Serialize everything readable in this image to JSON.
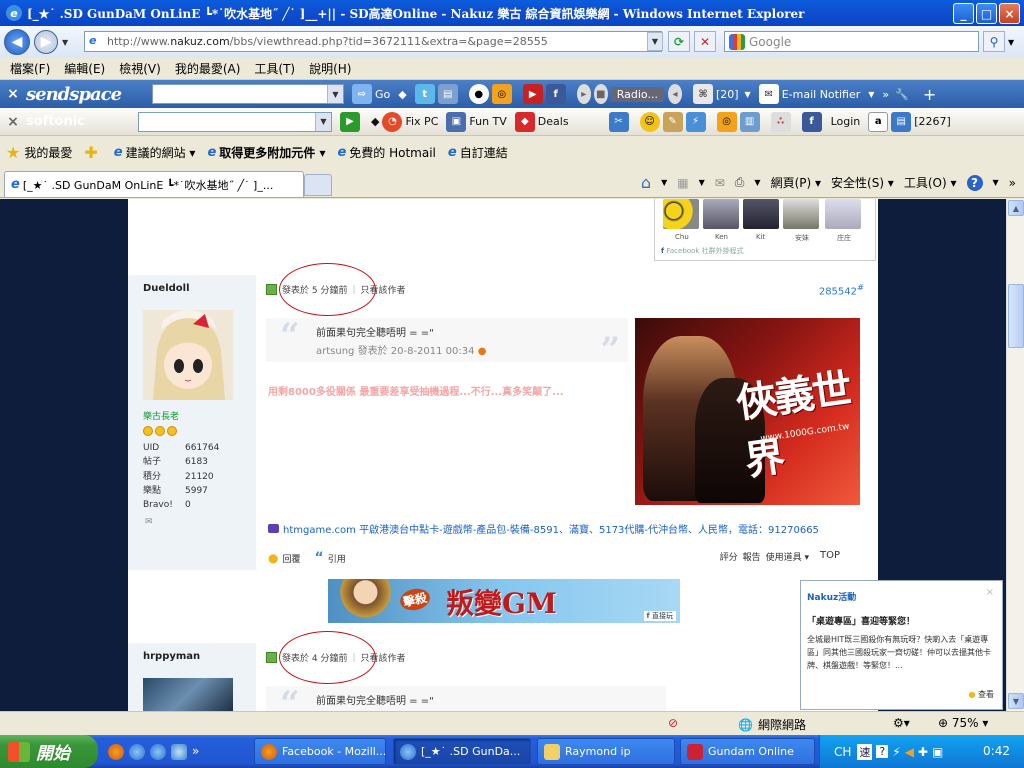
{
  "window": {
    "title": "[_★˙ .SD GunDaM OnLinE ┗*˙吹水基地˝ ╱˙ ]__+|| - SD高達Online - Nakuz 樂古 綜合資訊娛樂網 - Windows Internet Explorer",
    "controls": [
      "_",
      "□",
      "×"
    ]
  },
  "address": {
    "url_prefix": "http://www.",
    "url_domain": "nakuz.com",
    "url_path": "/bbs/viewthread.php?tid=3672111&extra=&page=28555",
    "search_placeholder": "Google"
  },
  "menu": [
    "檔案(F)",
    "編輯(E)",
    "檢視(V)",
    "我的最愛(A)",
    "工具(T)",
    "說明(H)"
  ],
  "toolbar1": {
    "brand": "sendspace",
    "go_label": "Go",
    "radio_label": "Radio...",
    "count_label": "[20]",
    "email_label": "E-mail Notifier"
  },
  "toolbar2": {
    "brand": "softonic",
    "fixpc": "Fix PC",
    "funtv": "Fun TV",
    "deals": "Deals",
    "login": "Login",
    "count": "[2267]"
  },
  "favorites": {
    "label": "我的最愛",
    "items": [
      "建議的網站 ▾",
      "取得更多附加元件 ▾",
      "免費的 Hotmail",
      "自訂連結"
    ]
  },
  "tab": {
    "title": "[_★˙ .SD GunDaM OnLinE ┗*˙吹水基地˝ ╱˙ ]_...",
    "commands": [
      "網頁(P) ▾",
      "安全性(S) ▾",
      "工具(O) ▾"
    ]
  },
  "fb_widget": {
    "names": [
      "Chu",
      "Ken",
      "Kit",
      "安妹",
      "庄庄"
    ],
    "footer": "Facebook 社群外掛程式"
  },
  "post1": {
    "username": "Dueldoll",
    "rank": "樂古長老",
    "stats": [
      {
        "k": "UID",
        "v": "661764"
      },
      {
        "k": "帖子",
        "v": "6183"
      },
      {
        "k": "積分",
        "v": "21120"
      },
      {
        "k": "樂點",
        "v": "5997"
      },
      {
        "k": "Bravo!",
        "v": "0"
      }
    ],
    "posted": "發表於 5 分鐘前",
    "author_only": "只看該作者",
    "post_no": "285542",
    "post_no_suffix": "#",
    "quote": "前面果句完全聽唔明 = =\"",
    "quote_by": "artsung 發表於 20-8-2011 00:34",
    "message": "用剩8000多役關係 最重要差享受抽機過程...不行...真多笑顛了...",
    "ad_title": "俠義世界",
    "ad_url": "www.1000G.com.tw",
    "htm_line": "htmgame.com 平啟港澳台中點卡-遊戲幣-產品包-裝備-8591、滿寶、5173代購-代沖台幣、人民幣，電話：91270665",
    "reply": "回覆",
    "quote_btn": "引用",
    "rate": "評分",
    "report": "報告",
    "use_item": "使用道具 ▾",
    "top": "TOP"
  },
  "banner": {
    "text": "叛變GM",
    "badge": "擊殺",
    "fb": "直接玩"
  },
  "post2": {
    "username": "hrppyman",
    "posted": "發表於 4 分鐘前",
    "author_only": "只看該作者",
    "quote": "前面果句完全聽唔明 = =\""
  },
  "notification": {
    "header": "Nakuz活動",
    "close": "×",
    "title": "「桌遊專區」喜迎等緊您！",
    "body": "全城最HIT既三國殺你有無玩呀？快啲入去「桌遊專區」同其他三國殺玩家一齊切磋！仲可以去搵其他卡牌、棋盤遊戲！等緊您！...",
    "more": "查看"
  },
  "status": {
    "zone": "網際網路",
    "zoom": "75% ▾"
  },
  "taskbar": {
    "start": "開始",
    "buttons": [
      "Facebook - Mozill...",
      "[_★˙ .SD GunDa...",
      "Raymond ip",
      "Gundam Online"
    ],
    "tray_lang": "CH",
    "clock": "0:42"
  }
}
